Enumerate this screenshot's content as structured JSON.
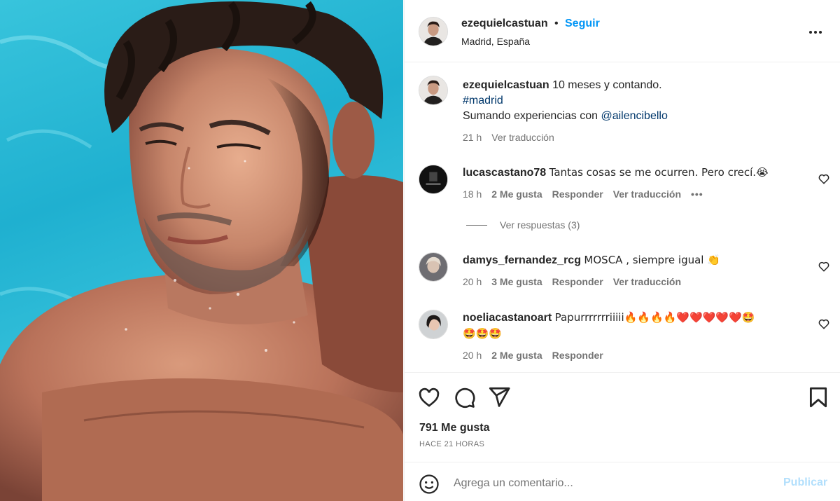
{
  "post": {
    "author": "ezequielcastuan",
    "separator": "•",
    "follow_label": "Seguir",
    "location": "Madrid, España",
    "more_icon": "more-horizontal-icon"
  },
  "caption": {
    "username": "ezequielcastuan",
    "line1": "10 meses y contando.",
    "hashtag": "#madrid",
    "line3_prefix": "Sumando experiencias con ",
    "mention": "@ailencibello",
    "time": "21 h",
    "translate": "Ver traducción"
  },
  "comments": [
    {
      "username": "lucascastano78",
      "text": "Tantas cosas se me ocurren. Pero crecí.😭",
      "time": "18 h",
      "likes": "2 Me gusta",
      "reply": "Responder",
      "translate": "Ver traducción",
      "replies_label": "Ver respuestas (3)"
    },
    {
      "username": "damys_fernandez_rcg",
      "text": "MOSCA , siempre igual 👏",
      "time": "20 h",
      "likes": "3 Me gusta",
      "reply": "Responder",
      "translate": "Ver traducción"
    },
    {
      "username": "noeliacastanoart",
      "text": "Papurrrrrrriiiii🔥🔥🔥🔥❤️❤️❤️❤️❤️🤩",
      "text2": "🤩🤩🤩",
      "time": "20 h",
      "likes": "2 Me gusta",
      "reply": "Responder"
    }
  ],
  "actions": {
    "like_count": "791 Me gusta",
    "posted_ago": "HACE 21 HORAS"
  },
  "add_comment": {
    "placeholder": "Agrega un comentario...",
    "post_label": "Publicar"
  },
  "colors": {
    "accent": "#0095f6",
    "link": "#00376b",
    "muted": "#737373",
    "pool": "#2bbad6"
  }
}
